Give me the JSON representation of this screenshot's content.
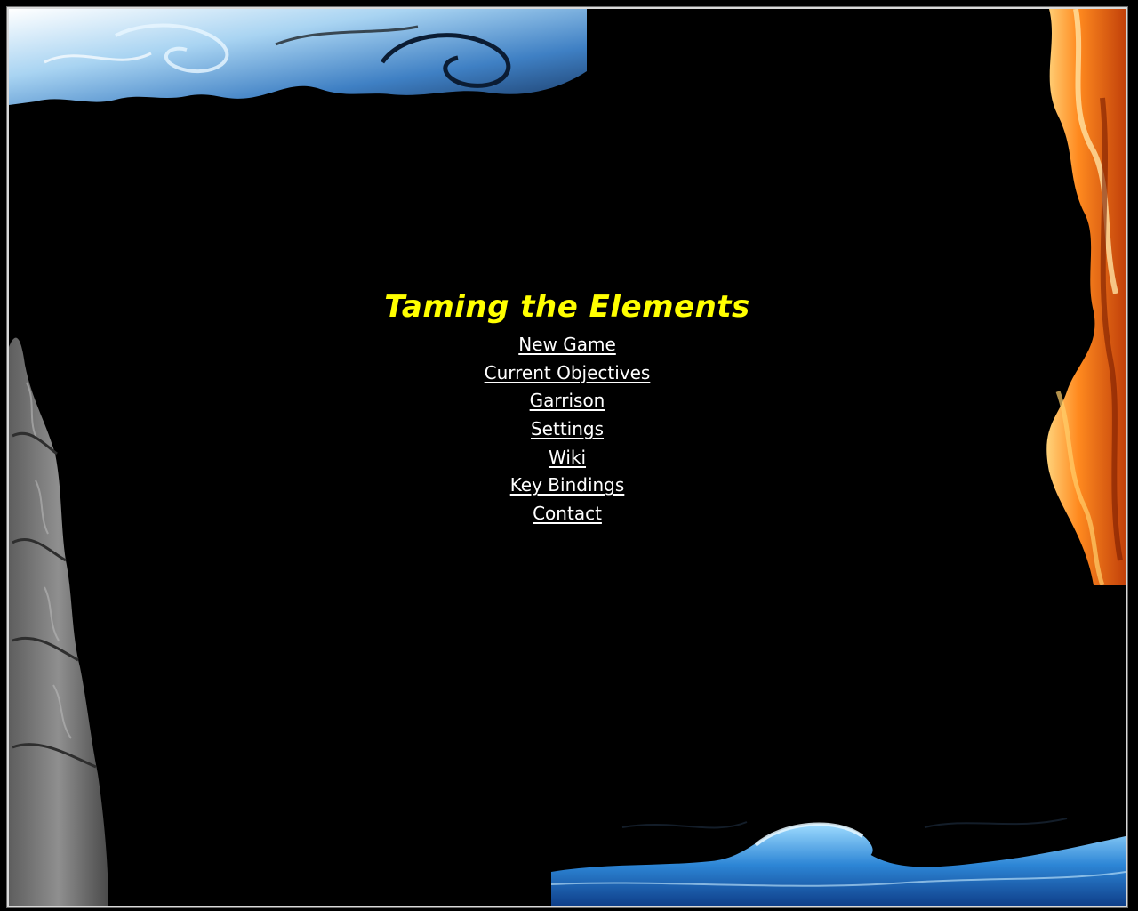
{
  "title": "Taming the Elements",
  "menu": {
    "items": [
      {
        "label": "New Game"
      },
      {
        "label": "Current Objectives"
      },
      {
        "label": "Garrison"
      },
      {
        "label": "Settings"
      },
      {
        "label": "Wiki"
      },
      {
        "label": "Key Bindings"
      },
      {
        "label": "Contact"
      }
    ]
  },
  "decorations": {
    "top_left": "air-swirl",
    "right": "fire-flame",
    "left": "earth-rock-pillar",
    "bottom_right": "water-wave"
  },
  "colors": {
    "background": "#000000",
    "title": "#ffff00",
    "link": "#ffffff"
  }
}
